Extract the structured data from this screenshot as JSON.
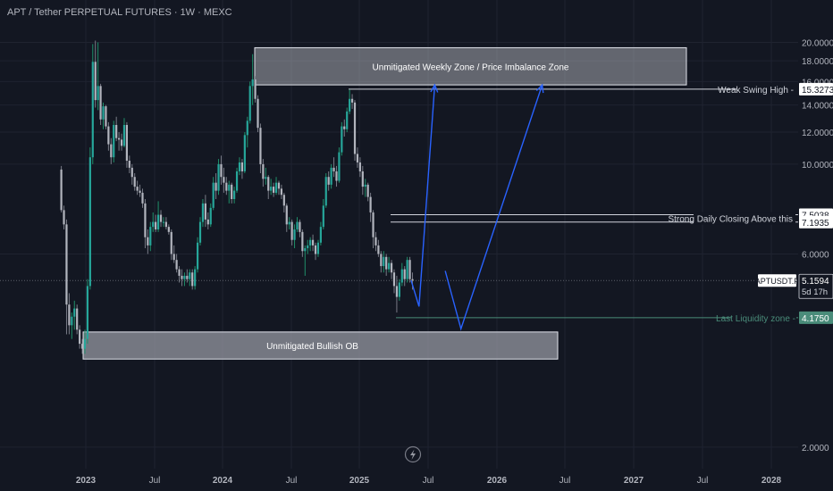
{
  "header": {
    "title": "APT / Tether PERPETUAL FUTURES · 1W · MEXC"
  },
  "colors": {
    "background": "#131722",
    "grid": "#1f2330",
    "axis_text": "#b2b5be",
    "candle_up": "#26a69a",
    "candle_up_wick": "#1f8f6a",
    "candle_down": "#b2b5be",
    "projection": "#2962ff",
    "zone_fill": "#d1d4dc",
    "current_price_tag": "#ffffff",
    "liquidity": "#4a8c7a"
  },
  "chart_data": {
    "type": "candlestick",
    "symbol": "APTUSDT.P",
    "interval": "1W",
    "exchange": "MEXC",
    "y_axis": {
      "scale": "log",
      "ticks": [
        "20.0000",
        "18.0000",
        "16.0000",
        "14.0000",
        "12.0000",
        "10.0000",
        "6.0000",
        "2.0000"
      ]
    },
    "x_axis": {
      "ticks": [
        "2023",
        "Jul",
        "2024",
        "Jul",
        "2025",
        "Jul",
        "2026",
        "Jul",
        "2027",
        "Jul",
        "2028"
      ]
    },
    "price_labels": [
      {
        "text": "15.3273",
        "value": 15.3273
      },
      {
        "text": "7.5038",
        "value": 7.5038
      },
      {
        "text": "7.1935",
        "value": 7.1935
      },
      {
        "text": "5.1594",
        "value": 5.1594
      },
      {
        "text": "5d 17h"
      },
      {
        "text": "4.1750",
        "value": 4.175
      }
    ],
    "current_price": {
      "symbol_tag": "APTUSDT.P",
      "price": "5.1594",
      "countdown": "5d 17h"
    },
    "annotations": [
      {
        "id": "weekly-zone",
        "text": "Unmitigated Weekly Zone / Price Imbalance Zone",
        "price_low": 15.7,
        "price_high": 19.4
      },
      {
        "id": "bullish-ob",
        "text": "Unmitigated Bullish OB",
        "price_low": 3.3,
        "price_high": 3.85
      },
      {
        "id": "weak-swing-high",
        "text": "Weak Swing High",
        "price": 15.3273
      },
      {
        "id": "strong-daily",
        "text": "Strong Daily Closing Above this",
        "price_a": 7.5038,
        "price_b": 7.1935
      },
      {
        "id": "last-liquidity",
        "text": "Last Liquidity zone",
        "price": 4.175
      }
    ],
    "candles_approx": [
      [
        "2022-10-24",
        9.7,
        9.9,
        7.6,
        7.7
      ],
      [
        "2022-10-31",
        7.7,
        7.9,
        6.9,
        7.1
      ],
      [
        "2022-11-07",
        7.1,
        7.3,
        3.8,
        4.5
      ],
      [
        "2022-11-14",
        4.5,
        4.8,
        3.8,
        4.0
      ],
      [
        "2022-11-21",
        4.0,
        4.3,
        3.7,
        4.2
      ],
      [
        "2022-11-28",
        4.2,
        4.6,
        3.9,
        4.4
      ],
      [
        "2022-12-05",
        4.4,
        4.5,
        3.8,
        3.9
      ],
      [
        "2022-12-12",
        3.9,
        4.0,
        3.5,
        3.6
      ],
      [
        "2022-12-19",
        3.6,
        3.7,
        3.4,
        3.5
      ],
      [
        "2022-12-26",
        3.5,
        3.9,
        3.4,
        3.7
      ],
      [
        "2023-01-02",
        3.7,
        5.2,
        3.6,
        5.0
      ],
      [
        "2023-01-09",
        5.0,
        11.0,
        4.9,
        10.4
      ],
      [
        "2023-01-16",
        10.4,
        19.8,
        10.0,
        17.9
      ],
      [
        "2023-01-23",
        17.9,
        20.2,
        13.8,
        14.4
      ],
      [
        "2023-01-30",
        14.4,
        20.0,
        13.6,
        15.6
      ],
      [
        "2023-02-06",
        15.6,
        15.8,
        12.5,
        12.9
      ],
      [
        "2023-02-13",
        12.9,
        14.2,
        12.2,
        13.9
      ],
      [
        "2023-02-20",
        13.9,
        14.0,
        12.2,
        12.4
      ],
      [
        "2023-02-27",
        12.4,
        12.7,
        10.8,
        11.2
      ],
      [
        "2023-03-06",
        11.2,
        11.6,
        10.0,
        10.4
      ],
      [
        "2023-03-13",
        10.4,
        12.8,
        10.1,
        12.5
      ],
      [
        "2023-03-20",
        12.5,
        13.1,
        11.4,
        11.6
      ],
      [
        "2023-03-27",
        11.6,
        12.0,
        10.8,
        11.5
      ],
      [
        "2023-04-03",
        11.5,
        11.9,
        10.8,
        11.1
      ],
      [
        "2023-04-10",
        11.1,
        13.0,
        11.0,
        12.5
      ],
      [
        "2023-04-17",
        12.5,
        12.7,
        9.8,
        10.2
      ],
      [
        "2023-04-24",
        10.2,
        10.5,
        9.5,
        9.8
      ],
      [
        "2023-05-01",
        9.8,
        10.0,
        8.9,
        9.3
      ],
      [
        "2023-05-08",
        9.3,
        9.5,
        8.6,
        8.8
      ],
      [
        "2023-05-15",
        8.8,
        9.1,
        8.4,
        8.6
      ],
      [
        "2023-05-22",
        8.6,
        8.9,
        8.3,
        8.5
      ],
      [
        "2023-05-29",
        8.5,
        8.7,
        7.8,
        8.0
      ],
      [
        "2023-06-05",
        8.0,
        8.2,
        6.2,
        6.6
      ],
      [
        "2023-06-12",
        6.6,
        6.9,
        6.0,
        6.3
      ],
      [
        "2023-06-19",
        6.3,
        7.2,
        6.1,
        7.0
      ],
      [
        "2023-06-26",
        7.0,
        7.6,
        6.8,
        7.2
      ],
      [
        "2023-07-03",
        7.2,
        7.5,
        6.8,
        6.9
      ],
      [
        "2023-07-10",
        6.9,
        8.1,
        6.8,
        7.5
      ],
      [
        "2023-07-17",
        7.5,
        7.7,
        7.0,
        7.2
      ],
      [
        "2023-07-24",
        7.2,
        7.4,
        7.0,
        7.2
      ],
      [
        "2023-07-31",
        7.2,
        7.4,
        6.9,
        7.0
      ],
      [
        "2023-08-07",
        7.0,
        7.1,
        6.7,
        6.8
      ],
      [
        "2023-08-14",
        6.8,
        6.9,
        5.8,
        6.0
      ],
      [
        "2023-08-21",
        6.0,
        6.3,
        5.7,
        5.8
      ],
      [
        "2023-08-28",
        5.8,
        6.0,
        5.4,
        5.5
      ],
      [
        "2023-09-04",
        5.5,
        5.6,
        5.1,
        5.3
      ],
      [
        "2023-09-11",
        5.3,
        5.5,
        5.0,
        5.2
      ],
      [
        "2023-09-18",
        5.2,
        5.4,
        5.0,
        5.3
      ],
      [
        "2023-09-25",
        5.3,
        5.5,
        5.1,
        5.2
      ],
      [
        "2023-10-02",
        5.2,
        5.5,
        5.0,
        5.4
      ],
      [
        "2023-10-09",
        5.4,
        5.5,
        4.9,
        5.0
      ],
      [
        "2023-10-16",
        5.0,
        5.6,
        4.9,
        5.5
      ],
      [
        "2023-10-23",
        5.5,
        6.6,
        5.4,
        6.4
      ],
      [
        "2023-10-30",
        6.4,
        7.4,
        6.3,
        7.2
      ],
      [
        "2023-11-06",
        7.2,
        8.2,
        7.0,
        8.0
      ],
      [
        "2023-11-13",
        8.0,
        8.4,
        7.0,
        7.3
      ],
      [
        "2023-11-20",
        7.3,
        7.6,
        6.9,
        7.1
      ],
      [
        "2023-11-27",
        7.1,
        8.0,
        7.0,
        7.8
      ],
      [
        "2023-12-04",
        7.8,
        9.3,
        7.7,
        9.0
      ],
      [
        "2023-12-11",
        9.0,
        9.5,
        8.2,
        8.6
      ],
      [
        "2023-12-18",
        8.6,
        10.3,
        8.4,
        10.0
      ],
      [
        "2023-12-25",
        10.0,
        10.5,
        8.9,
        9.3
      ],
      [
        "2024-01-01",
        9.3,
        9.8,
        8.5,
        9.0
      ],
      [
        "2024-01-08",
        9.0,
        9.3,
        8.4,
        8.6
      ],
      [
        "2024-01-15",
        8.6,
        9.1,
        8.0,
        8.9
      ],
      [
        "2024-01-22",
        8.9,
        9.0,
        8.0,
        8.2
      ],
      [
        "2024-01-29",
        8.2,
        8.8,
        8.0,
        8.6
      ],
      [
        "2024-02-05",
        8.6,
        9.8,
        8.5,
        9.6
      ],
      [
        "2024-02-12",
        9.6,
        10.4,
        9.4,
        10.1
      ],
      [
        "2024-02-19",
        10.1,
        10.3,
        9.2,
        9.6
      ],
      [
        "2024-02-26",
        9.6,
        12.0,
        9.5,
        11.8
      ],
      [
        "2024-03-04",
        11.8,
        13.1,
        11.0,
        12.8
      ],
      [
        "2024-03-11",
        12.8,
        16.0,
        12.6,
        15.6
      ],
      [
        "2024-03-18",
        15.6,
        18.7,
        14.0,
        16.2
      ],
      [
        "2024-03-25",
        16.2,
        16.5,
        14.2,
        14.5
      ],
      [
        "2024-04-01",
        14.5,
        14.8,
        12.0,
        12.3
      ],
      [
        "2024-04-08",
        12.3,
        12.6,
        9.5,
        10.0
      ],
      [
        "2024-04-15",
        10.0,
        10.3,
        8.8,
        9.2
      ],
      [
        "2024-04-22",
        9.2,
        9.8,
        8.9,
        9.3
      ],
      [
        "2024-04-29",
        9.3,
        9.4,
        8.2,
        8.6
      ],
      [
        "2024-05-06",
        8.6,
        9.2,
        8.4,
        8.8
      ],
      [
        "2024-05-13",
        8.8,
        9.0,
        8.3,
        8.5
      ],
      [
        "2024-05-20",
        8.5,
        9.3,
        8.4,
        9.0
      ],
      [
        "2024-05-27",
        9.0,
        9.1,
        8.4,
        8.7
      ],
      [
        "2024-06-03",
        8.7,
        8.9,
        8.2,
        8.4
      ],
      [
        "2024-06-10",
        8.4,
        8.5,
        7.6,
        7.9
      ],
      [
        "2024-06-17",
        7.9,
        8.0,
        6.8,
        7.1
      ],
      [
        "2024-06-24",
        7.1,
        7.4,
        6.9,
        7.2
      ],
      [
        "2024-07-01",
        7.2,
        7.3,
        6.3,
        6.5
      ],
      [
        "2024-07-08",
        6.5,
        7.1,
        6.2,
        6.9
      ],
      [
        "2024-07-15",
        6.9,
        7.4,
        6.8,
        7.2
      ],
      [
        "2024-07-22",
        7.2,
        7.3,
        6.6,
        6.8
      ],
      [
        "2024-07-29",
        6.8,
        6.9,
        5.9,
        6.1
      ],
      [
        "2024-08-05",
        6.1,
        6.3,
        5.3,
        6.2
      ],
      [
        "2024-08-12",
        6.2,
        6.5,
        6.0,
        6.3
      ],
      [
        "2024-08-19",
        6.3,
        6.6,
        6.1,
        6.5
      ],
      [
        "2024-08-26",
        6.5,
        6.7,
        6.1,
        6.3
      ],
      [
        "2024-09-02",
        6.3,
        6.4,
        5.8,
        6.0
      ],
      [
        "2024-09-09",
        6.0,
        6.5,
        5.9,
        6.4
      ],
      [
        "2024-09-16",
        6.4,
        7.2,
        6.3,
        7.0
      ],
      [
        "2024-09-23",
        7.0,
        8.2,
        6.9,
        7.9
      ],
      [
        "2024-09-30",
        7.9,
        9.5,
        7.8,
        9.3
      ],
      [
        "2024-10-07",
        9.3,
        9.6,
        8.6,
        8.9
      ],
      [
        "2024-10-14",
        8.9,
        10.0,
        8.7,
        9.8
      ],
      [
        "2024-10-21",
        9.8,
        10.4,
        9.3,
        9.6
      ],
      [
        "2024-10-28",
        9.6,
        9.9,
        8.8,
        9.1
      ],
      [
        "2024-11-04",
        9.1,
        11.0,
        9.0,
        10.7
      ],
      [
        "2024-11-11",
        10.7,
        12.7,
        10.5,
        12.4
      ],
      [
        "2024-11-18",
        12.4,
        12.9,
        11.7,
        12.2
      ],
      [
        "2024-11-25",
        12.2,
        13.8,
        12.0,
        13.5
      ],
      [
        "2024-12-02",
        13.5,
        15.3,
        13.3,
        14.5
      ],
      [
        "2024-12-09",
        14.5,
        14.9,
        13.7,
        14.2
      ],
      [
        "2024-12-16",
        14.2,
        14.4,
        10.2,
        10.6
      ],
      [
        "2024-12-23",
        10.6,
        11.0,
        9.8,
        10.1
      ],
      [
        "2024-12-30",
        10.1,
        10.4,
        9.3,
        9.6
      ],
      [
        "2025-01-06",
        9.6,
        9.9,
        8.4,
        8.8
      ],
      [
        "2025-01-13",
        8.8,
        9.2,
        8.3,
        8.9
      ],
      [
        "2025-01-20",
        8.9,
        9.0,
        8.1,
        8.3
      ],
      [
        "2025-01-27",
        8.3,
        8.5,
        7.2,
        7.6
      ],
      [
        "2025-02-03",
        7.6,
        7.7,
        6.2,
        6.6
      ],
      [
        "2025-02-10",
        6.6,
        6.8,
        6.1,
        6.3
      ],
      [
        "2025-02-17",
        6.3,
        6.5,
        5.9,
        6.0
      ],
      [
        "2025-02-24",
        6.0,
        6.1,
        5.4,
        5.6
      ],
      [
        "2025-03-03",
        5.6,
        6.1,
        5.4,
        5.9
      ],
      [
        "2025-03-10",
        5.9,
        6.0,
        5.3,
        5.5
      ],
      [
        "2025-03-17",
        5.5,
        5.9,
        5.4,
        5.7
      ],
      [
        "2025-03-24",
        5.7,
        5.8,
        5.2,
        5.4
      ],
      [
        "2025-03-31",
        5.4,
        5.5,
        4.8,
        5.0
      ],
      [
        "2025-04-07",
        5.0,
        5.3,
        4.3,
        4.7
      ],
      [
        "2025-04-14",
        4.7,
        5.2,
        4.6,
        5.1
      ],
      [
        "2025-04-21",
        5.1,
        5.7,
        5.0,
        5.5
      ],
      [
        "2025-04-28",
        5.5,
        5.6,
        5.0,
        5.2
      ],
      [
        "2025-05-05",
        5.2,
        5.9,
        5.1,
        5.8
      ],
      [
        "2025-05-12",
        5.8,
        5.9,
        5.1,
        5.2
      ],
      [
        "2025-05-19",
        5.2,
        5.4,
        4.9,
        5.1594
      ]
    ],
    "projection_path": [
      [
        "2025-05-19",
        5.16
      ],
      [
        "2025-06-09",
        4.45
      ],
      [
        "2025-07-21",
        15.7
      ]
    ],
    "projection_path_2": [
      [
        "2025-08-18",
        5.45
      ],
      [
        "2025-09-29",
        3.92
      ],
      [
        "2026-05-04",
        15.7
      ]
    ]
  },
  "footer": {
    "event_marker_icon": "lightning-icon"
  }
}
